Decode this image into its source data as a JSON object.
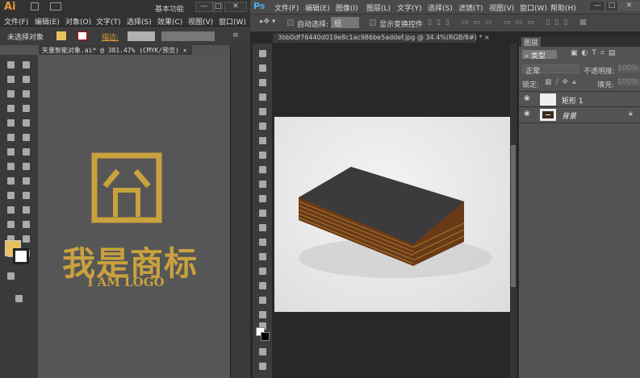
{
  "ai": {
    "logo": "Ai",
    "workspace": "基本功能",
    "menu": [
      "文件(F)",
      "编辑(E)",
      "对象(O)",
      "文字(T)",
      "选择(S)",
      "效果(C)",
      "视图(V)",
      "窗口(W)"
    ],
    "control": {
      "selection": "未选择对象",
      "stroke_label": "描边:"
    },
    "doc_tab": "矢量智能对象.ai* @ 381.47% (CMYK/预览)",
    "artwork": {
      "title": "我是商标",
      "subtitle": "I AM LOGO",
      "color": "#c9a13e"
    }
  },
  "ps": {
    "logo": "Ps",
    "menu": [
      "文件(F)",
      "编辑(E)",
      "图像(I)",
      "图层(L)",
      "文字(Y)",
      "选择(S)",
      "滤镜(T)",
      "视图(V)",
      "窗口(W)",
      "帮助(H)"
    ],
    "options": {
      "auto_select": "自动选择:",
      "auto_select_value": "组",
      "show_transform": "显示变换控件"
    },
    "doc_tab": "3bb0df76440d019e8c1ac986be5addef.jpg @ 34.4%(RGB/8#) *",
    "layers": {
      "title": "图层",
      "filter": "类型",
      "blend": "正常",
      "opacity_label": "不透明度:",
      "opacity": "100%",
      "lock_label": "锁定:",
      "fill_label": "填充:",
      "fill": "100%",
      "items": [
        {
          "name": "矩形 1"
        },
        {
          "name": "背景"
        }
      ]
    }
  },
  "window": {
    "minimize": "—",
    "maximize": "□",
    "close": "✕"
  }
}
